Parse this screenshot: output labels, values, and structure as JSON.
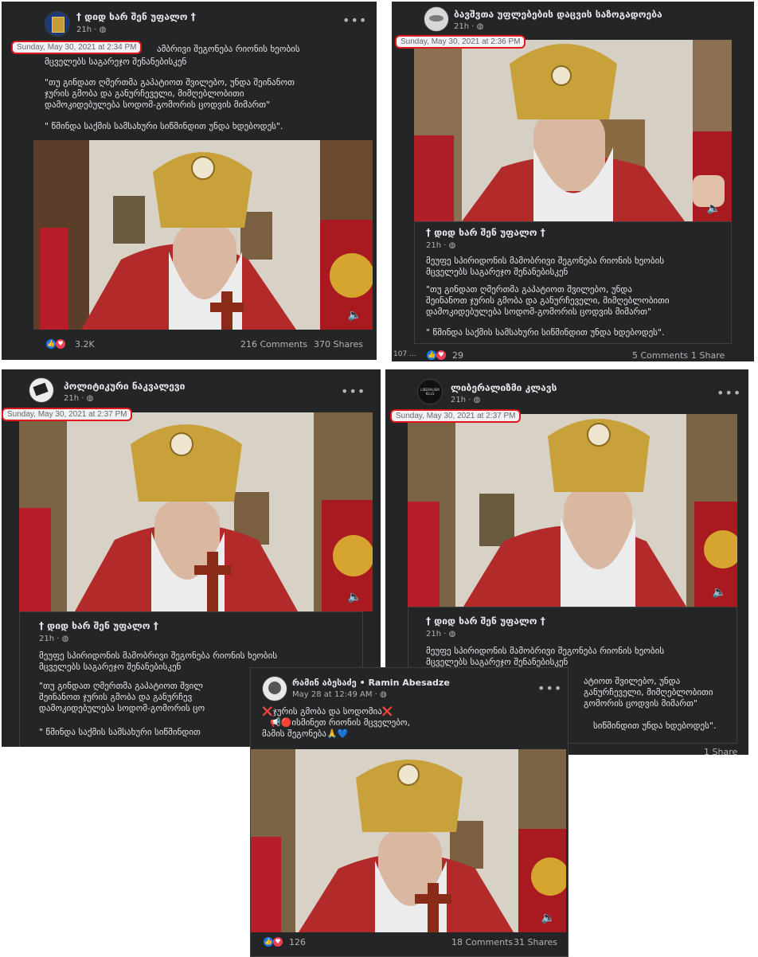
{
  "posts": [
    {
      "page_name": "† დიდ ხარ შენ უფალო †",
      "meta": "21h · ",
      "timestamp": "Sunday, May 30, 2021 at 2:34 PM",
      "line1": "ამბრივი შეგონება რიონის ხეობის",
      "line2": "მცველებს საგარეჯო შენანებისკენ",
      "quote1": "\"თუ გინდათ ღმერთმა გაპატიოთ შვილებო, უნდა შეინანოთ",
      "quote2": "ჯურის გმობა და განურჩეველი, მიმღებლობითი",
      "quote3": "დამოკიდებულება სოდომ-გომორის ცოდვის მიმართ\"",
      "quote4": "\" წმინდა საქმის სამსახური სიწმინდით უნდა ხდებოდეს\".",
      "reactions": "3.2K",
      "comments": "216 Comments",
      "shares": "370 Shares"
    },
    {
      "page_name": "ბავშვთა უფლებების დაცვის საზოგადოება",
      "meta": "21h · ",
      "timestamp": "Sunday, May 30, 2021 at 2:36 PM",
      "shared_name": "† დიდ ხარ შენ უფალო †",
      "shared_meta": "21h · ",
      "line1": "მეუფე სპირიდონის მამობრივი შეგონება რიონის ხეობის",
      "line2": "მცველებს საგარეჯო შენანებისკენ",
      "quote1": "\"თუ გინდათ ღმერთმა გაპატიოთ შვილებო, უნდა",
      "quote2": "შეინანოთ ჯურის გმობა და განურჩეველი, მიმღებლობითი",
      "quote3": "დამოკიდებულება სოდომ-გომორის ცოდვის მიმართ\"",
      "quote4": "\" წმინდა საქმის სამსახური სიწმინდით უნდა ხდებოდეს\".",
      "left_label": "107 ...",
      "reactions": "29",
      "comments": "5 Comments",
      "shares": "1 Share"
    },
    {
      "page_name": "პოლიტიკური ნაკვალევი",
      "meta": "21h · ",
      "timestamp": "Sunday, May 30, 2021 at 2:37 PM",
      "shared_name": "† დიდ ხარ შენ უფალო †",
      "shared_meta": "21h · ",
      "line1": "მეუფე სპირიდონის მამობრივი შეგონება რიონის ხეობის",
      "line2": "მცველებს საგარეჯო შენანებისკენ",
      "quote1": "\"თუ გინდათ ღმერთმა გაპატიოთ შვილ",
      "quote2": "შეინანოთ ჯურის გმობა და განურჩევ",
      "quote3": "დამოკიდებულება სოდომ-გომორის ცო",
      "quote4": "\" წმინდა საქმის სამსახური სიწმინდით"
    },
    {
      "page_name": "ლიბერალიზმი კლავს",
      "avatar_text": "LIBERALISM KILLS",
      "meta": "21h · ",
      "timestamp": "Sunday, May 30, 2021 at 2:37 PM",
      "shared_name": "† დიდ ხარ შენ უფალო †",
      "shared_meta": "21h · ",
      "line1": "მეუფე სპირიდონის მამობრივი შეგონება რიონის ხეობის",
      "line2": "მცველებს საგარეჯო შენანებისკენ",
      "quote1": "ატიოთ შვილებო, უნდა",
      "quote2": "განურჩეველი, მიმღებლობითი",
      "quote3": "გომორის ცოდვის მიმართ\"",
      "quote4": "სიწმინდით უნდა ხდებოდეს\".",
      "shares": "1 Share"
    },
    {
      "page_name": "რამინ აბესაძე • Ramin Abesadze",
      "meta": "May 28 at 12:49 AM · ",
      "line1": "❌ჯურის გმობა და სოდომია❌",
      "line2": "📢🔴ისმინეთ  რიონის მცველებო,",
      "line3": "მამის შეგონება🙏💙",
      "reactions": "126",
      "comments": "18 Comments",
      "shares": "31 Shares"
    }
  ],
  "icons": {
    "more": "more-options-icon",
    "globe": "globe-icon",
    "like": "like-icon",
    "love": "love-icon",
    "speaker": "speaker-icon"
  },
  "colors": {
    "post_bg": "#242526",
    "highlight": "#e0161c",
    "like": "#1877f2",
    "love": "#f33e58"
  }
}
